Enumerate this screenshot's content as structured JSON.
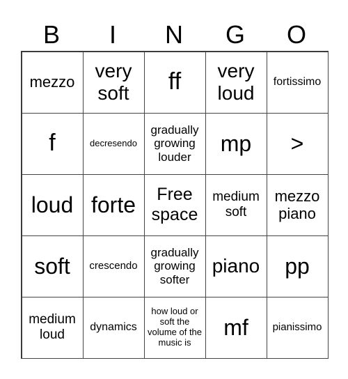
{
  "header": [
    "B",
    "I",
    "N",
    "G",
    "O"
  ],
  "cells": [
    {
      "text": "mezzo",
      "size": 22
    },
    {
      "text": "very soft",
      "size": 28
    },
    {
      "text": "ff",
      "size": 34
    },
    {
      "text": "very loud",
      "size": 28
    },
    {
      "text": "fortissimo",
      "size": 16
    },
    {
      "text": "f",
      "size": 34
    },
    {
      "text": "decresendo",
      "size": 13
    },
    {
      "text": "gradually growing louder",
      "size": 17
    },
    {
      "text": "mp",
      "size": 32
    },
    {
      "text": ">",
      "size": 32
    },
    {
      "text": "loud",
      "size": 32
    },
    {
      "text": "forte",
      "size": 32
    },
    {
      "text": "Free space",
      "size": 25
    },
    {
      "text": "medium soft",
      "size": 19
    },
    {
      "text": "mezzo piano",
      "size": 22
    },
    {
      "text": "soft",
      "size": 32
    },
    {
      "text": "crescendo",
      "size": 15
    },
    {
      "text": "gradually growing softer",
      "size": 17
    },
    {
      "text": "piano",
      "size": 28
    },
    {
      "text": "pp",
      "size": 32
    },
    {
      "text": "medium loud",
      "size": 19
    },
    {
      "text": "dynamics",
      "size": 16
    },
    {
      "text": "how loud or soft the volume of the music is",
      "size": 13
    },
    {
      "text": "mf",
      "size": 32
    },
    {
      "text": "pianissimo",
      "size": 15
    }
  ]
}
